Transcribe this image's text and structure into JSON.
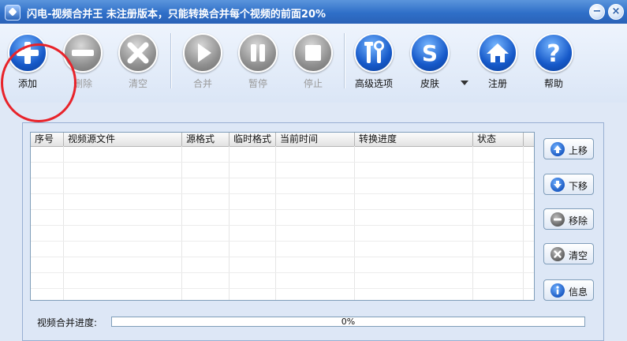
{
  "window": {
    "title": "闪电-视频合并王  未注册版本，只能转换合并每个视频的前面20%"
  },
  "toolbar": {
    "buttons": [
      {
        "label": "添加",
        "icon": "plus-icon",
        "enabled": true
      },
      {
        "label": "删除",
        "icon": "minus-icon",
        "enabled": false
      },
      {
        "label": "清空",
        "icon": "x-icon",
        "enabled": false
      },
      {
        "label": "合并",
        "icon": "play-icon",
        "enabled": false
      },
      {
        "label": "暂停",
        "icon": "pause-icon",
        "enabled": false
      },
      {
        "label": "停止",
        "icon": "stop-icon",
        "enabled": false
      },
      {
        "label": "高级选项",
        "icon": "tools-icon",
        "enabled": true
      },
      {
        "label": "皮肤",
        "icon": "skin-s-icon",
        "enabled": true
      },
      {
        "label": "注册",
        "icon": "home-icon",
        "enabled": true
      },
      {
        "label": "帮助",
        "icon": "question-icon",
        "enabled": true
      }
    ]
  },
  "file_list": {
    "columns": [
      "序号",
      "视频源文件",
      "源格式",
      "临时格式",
      "当前时间",
      "转换进度",
      "状态"
    ],
    "rows": []
  },
  "side_buttons": [
    {
      "label": "上移",
      "icon": "arrow-up-icon"
    },
    {
      "label": "下移",
      "icon": "arrow-down-icon"
    },
    {
      "label": "移除",
      "icon": "minus-icon"
    },
    {
      "label": "清空",
      "icon": "x-icon"
    },
    {
      "label": "信息",
      "icon": "info-icon"
    }
  ],
  "progress": {
    "label": "视频合并进度:",
    "value_text": "0%",
    "fraction": 0
  },
  "colors": {
    "title_bar": "#2f6fc8",
    "accent_blue": "#1659c9",
    "disabled_gray": "#8e8e8e",
    "annotation_red": "#e8232a"
  }
}
